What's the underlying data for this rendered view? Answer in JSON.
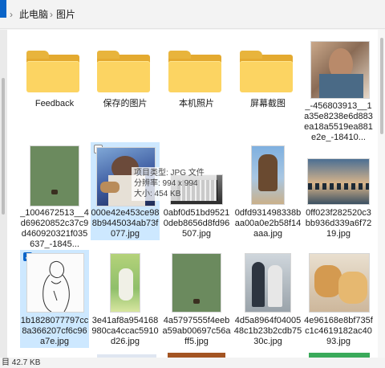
{
  "breadcrumb": [
    "此电脑",
    "图片"
  ],
  "items": [
    {
      "type": "folder",
      "name": "Feedback"
    },
    {
      "type": "folder",
      "name": "保存的图片"
    },
    {
      "type": "folder",
      "name": "本机照片"
    },
    {
      "type": "folder",
      "name": "屏幕截图"
    },
    {
      "type": "image",
      "name": "_-456803913__1a35e8238e6d883ea18a5519ea881e2e_-18410..."
    },
    {
      "type": "image",
      "name": "_1004672513__4d69620852c37c9d460920321f035637_-1845..."
    },
    {
      "type": "image",
      "name": "000e42e453ce988b9445034ab73f077.jpg",
      "hovered": true
    },
    {
      "type": "image",
      "name": "0abf0d51bd95210deb8656d8fd96507.jpg"
    },
    {
      "type": "image",
      "name": "0dfd931498338baa00a0e2b58f14aaa.jpg"
    },
    {
      "type": "image",
      "name": "0ff023f282520c3bb936d339a6f7219.jpg"
    },
    {
      "type": "image",
      "name": "1b1828077797cc8a366207cf6c96a7e.jpg",
      "selected": true
    },
    {
      "type": "image",
      "name": "3e41af8a954168980ca4ccac5910d26.jpg"
    },
    {
      "type": "image",
      "name": "4a5797555f4eeba59ab00697c56aff5.jpg"
    },
    {
      "type": "image",
      "name": "4d5a8964f0400548c1b23b2cdb7530c.jpg"
    },
    {
      "type": "image",
      "name": "4e96168e8bf735fc1c4619182ac4093.jpg"
    }
  ],
  "tooltip": {
    "line1": "项目类型: JPG 文件",
    "line2": "分辨率: 994 x 994",
    "line3": "大小: 454 KB"
  },
  "status": "目 42.7 KB"
}
